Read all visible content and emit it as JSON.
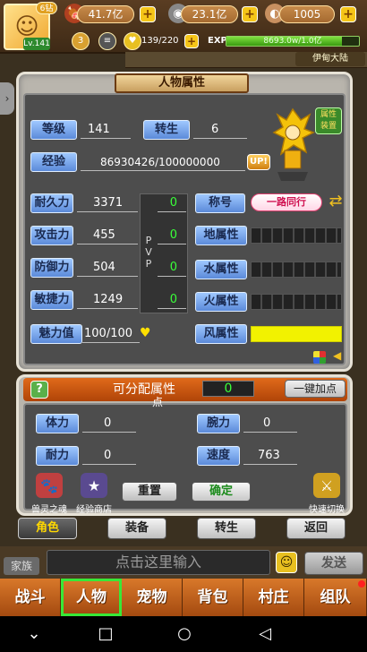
{
  "player": {
    "vip": "6钻",
    "level": "Lv.141"
  },
  "resources": [
    {
      "name": "meat",
      "icon": "meat-icon",
      "value": "41.7亿"
    },
    {
      "name": "silver",
      "icon": "coin-icon",
      "value": "23.1亿"
    },
    {
      "name": "gold",
      "icon": "shell-icon",
      "value": "1005"
    }
  ],
  "status": {
    "rank_badge": "3",
    "stamina": "139/220",
    "exp_label": "EXP",
    "exp_text": "8693.0w/1.0亿",
    "exp_fraction": 0.87,
    "map_name": "伊甸大陆"
  },
  "panel": {
    "title": "人物属性",
    "level_label": "等级",
    "level_value": "141",
    "rebirth_label": "转生",
    "rebirth_value": "6",
    "exp_label": "经验",
    "exp_value": "86930426/100000000",
    "up_label": "UP!",
    "character_button": "属性\n装置"
  },
  "stats": [
    {
      "label": "耐久力",
      "value": "3371",
      "pvp": "0"
    },
    {
      "label": "攻击力",
      "value": "455",
      "pvp": "0"
    },
    {
      "label": "防御力",
      "value": "504",
      "pvp": "0"
    },
    {
      "label": "敏捷力",
      "value": "1249",
      "pvp": "0"
    }
  ],
  "pvp_label": "PVP",
  "charm": {
    "label": "魅力值",
    "value": "100/100"
  },
  "title_label": "称号",
  "title_badge": "一路同行",
  "elements": [
    {
      "label": "地属性",
      "fill": 0
    },
    {
      "label": "水属性",
      "fill": 0
    },
    {
      "label": "火属性",
      "fill": 0
    },
    {
      "label": "风属性",
      "fill": 1
    }
  ],
  "allocation": {
    "title": "可分配属性",
    "title_suffix": "点",
    "points": "0",
    "one_click": "一键加点",
    "fields": [
      {
        "label": "体力",
        "value": "0"
      },
      {
        "label": "腕力",
        "value": "0"
      },
      {
        "label": "耐力",
        "value": "0"
      },
      {
        "label": "速度",
        "value": "763"
      }
    ],
    "reset": "重置",
    "confirm": "确定",
    "beast_soul": "兽灵之魂",
    "exp_shop": "经验商店",
    "quick_switch": "快速切换"
  },
  "subtabs": [
    "角色",
    "装备",
    "转生",
    "返回"
  ],
  "chat": {
    "family": "家族",
    "placeholder": "点击这里输入",
    "send": "发送"
  },
  "nav": [
    "战斗",
    "人物",
    "宠物",
    "背包",
    "村庄",
    "组队"
  ],
  "colors": {
    "accent_orange": "#d8782a",
    "active_green": "#38e838",
    "pvp_green": "#3aff3a",
    "wind_bar": "#f2f200"
  }
}
